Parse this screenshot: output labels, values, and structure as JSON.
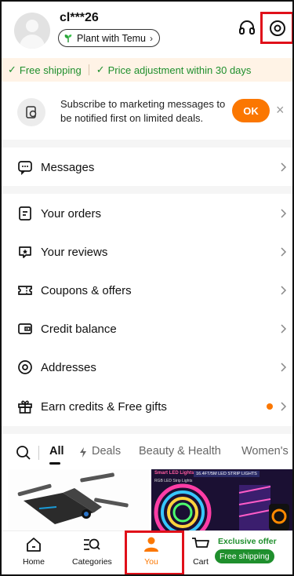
{
  "header": {
    "username": "cl***26",
    "plant_label": "Plant with Temu",
    "plant_chevron": "›"
  },
  "shipping_bar": {
    "items": [
      "Free shipping",
      "Price adjustment within 30 days"
    ],
    "check": "✓"
  },
  "subscribe": {
    "text": "Subscribe to marketing messages to be notified first on limited deals.",
    "ok_label": "OK",
    "close": "×"
  },
  "menu": [
    {
      "label": "Messages",
      "icon": "chat-bubble-icon"
    },
    {
      "label": "Your orders",
      "icon": "orders-icon"
    },
    {
      "label": "Your reviews",
      "icon": "reviews-icon"
    },
    {
      "label": "Coupons & offers",
      "icon": "coupon-icon"
    },
    {
      "label": "Credit balance",
      "icon": "wallet-icon"
    },
    {
      "label": "Addresses",
      "icon": "location-icon"
    },
    {
      "label": "Earn credits & Free gifts",
      "icon": "gift-icon"
    }
  ],
  "tabs": [
    "All",
    "Deals",
    "Beauty & Health",
    "Women's"
  ],
  "products": {
    "right_tag": "Smart LED Lights",
    "right_sub": "RGB LED Strip Lights",
    "right_banner": "16.4FT/5M LED STRIP LIGHTS"
  },
  "bottom_nav": {
    "home": "Home",
    "categories": "Categories",
    "you": "You",
    "cart": "Cart",
    "offer_title": "Exclusive offer",
    "offer_badge": "Free shipping"
  },
  "colors": {
    "accent_orange": "#fb7701",
    "green": "#1f8f2d",
    "highlight_red": "#e0101a"
  }
}
